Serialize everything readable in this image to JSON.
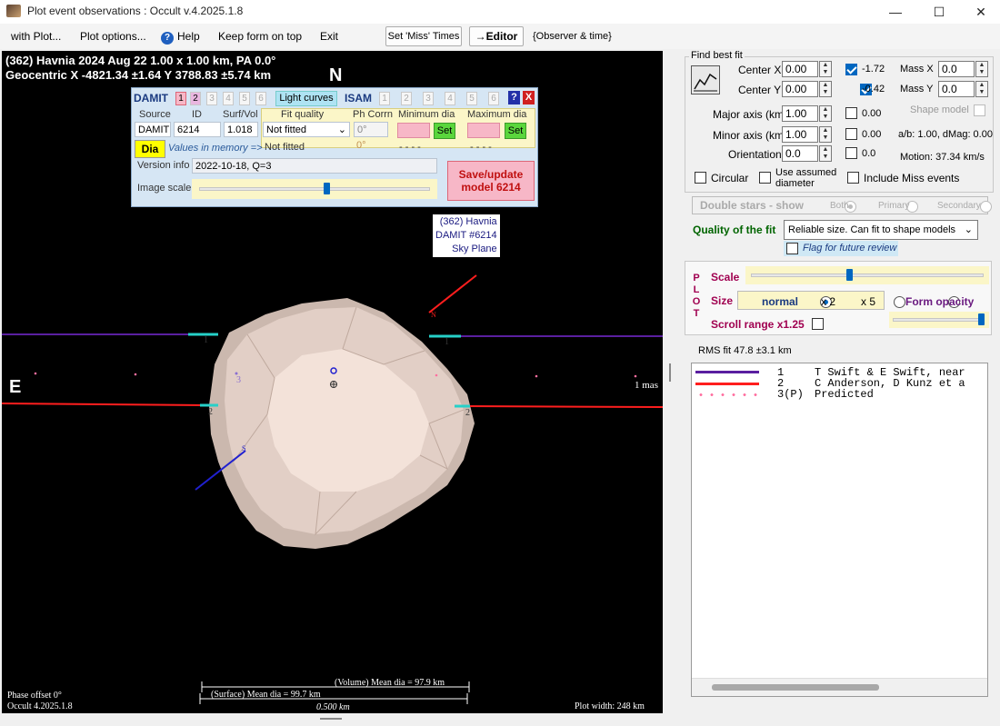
{
  "window": {
    "title": "Plot event observations : Occult v.4.2025.1.8",
    "minimize_icon": "minimize-icon",
    "maximize_icon": "maximize-icon",
    "close_icon": "close-icon"
  },
  "menu": {
    "items": [
      "with Plot...",
      "Plot options...",
      "Help",
      "Keep form on top",
      "Exit"
    ],
    "set_miss_times": "Set 'Miss' Times",
    "editor": "→Editor",
    "observer_time": "{Observer & time}"
  },
  "plot": {
    "header_line1": "(362) Havnia  2024 Aug 22   1.00 x 1.00 km, PA 0.0°",
    "header_line2": "Geocentric  X  -4821.34 ±1.64  Y 3788.83 ±5.74 km",
    "north": "N",
    "east": "E",
    "tag_lines": [
      "(362) Havnia",
      "DAMIT #6214",
      "Sky Plane"
    ],
    "scale_mas": "1 mas",
    "chord_labels": [
      "1",
      "1",
      "2",
      "2",
      "3"
    ],
    "pole_labels": [
      "N",
      "S"
    ],
    "phase_offset": "Phase offset 0°",
    "occult_version": "Occult 4.2025.1.8",
    "plot_width": "Plot width: 248 km",
    "volume_dia": "(Volume) Mean dia = 97.9 km",
    "surface_dia": "(Surface) Mean dia = 99.7 km",
    "scale_bar": "0.500 km",
    "colors": {
      "chord1": "#5a1fa0",
      "chord2": "#ff1e1e",
      "predicted": "#ff6fa0",
      "pole_n": "#ff1e1e",
      "pole_s": "#2020d0",
      "shape": "#f0ddd4"
    }
  },
  "damit": {
    "label": "DAMIT",
    "model_nums": [
      "1",
      "2",
      "3",
      "4",
      "5",
      "6"
    ],
    "light_curves": "Light curves",
    "isam": "ISAM",
    "isam_nums": [
      "1",
      "2",
      "3",
      "4",
      "5",
      "6"
    ],
    "help_q": "?",
    "close_x": "X",
    "col_source": "Source",
    "col_id": "ID",
    "col_surf": "Surf/Vol",
    "col_fit": "Fit quality",
    "col_phcorn": "Ph Corrn",
    "col_min": "Minimum dia",
    "col_max": "Maximum dia",
    "source": "DAMIT",
    "id": "6214",
    "surf": "1.018",
    "fit_quality": "Not fitted",
    "fit_quality2": "Not fitted",
    "ph_corr": "0°",
    "ph_corr2": "0°",
    "min_dash": "- - - -",
    "max_dash": "- - - -",
    "set": "Set",
    "dia": "Dia",
    "values_memory": "Values in memory =>",
    "version_label": "Version info",
    "version": "2022-10-18, Q=3",
    "image_scale": "Image scale",
    "save_line1": "Save/update",
    "save_line2": "model 6214",
    "image_scale_value": 0.55
  },
  "fit": {
    "group_label": "Find best fit",
    "fit_icon": "fit-chart-icon",
    "center_x_label": "Center X",
    "center_x": "0.00",
    "center_x_cb": "-1.72",
    "center_y_label": "Center Y",
    "center_y": "0.00",
    "center_y_cb": "-0.42",
    "mass_x_label": "Mass X",
    "mass_x": "0.0",
    "mass_y_label": "Mass Y",
    "mass_y": "0.0",
    "major_label": "Major axis (km)",
    "major": "1.00",
    "major_cb": "0.00",
    "minor_label": "Minor axis (km)",
    "minor": "1.00",
    "minor_cb": "0.00",
    "orient_label": "Orientation",
    "orient": "0.0",
    "orient_cb": "0.0",
    "shape_model": "Shape model",
    "ab_text": "a/b: 1.00, dMag: 0.00",
    "motion": "Motion: 37.34 km/s",
    "circular": "Circular",
    "use_assumed_1": "Use assumed",
    "use_assumed_2": "diameter",
    "include_miss": "Include Miss events",
    "double_stars": "Double stars - show",
    "both": "Both",
    "primary": "Primary",
    "secondary": "Secondary",
    "quality_label": "Quality of the fit",
    "quality_value": "Reliable size. Can fit to shape models",
    "flag_review": "Flag for future review"
  },
  "plotopts": {
    "plot_letters": [
      "P",
      "L",
      "O",
      "T"
    ],
    "scale": "Scale",
    "size": "Size",
    "normal": "normal",
    "x2": "x 2",
    "x5": "x 5",
    "form_opacity": "Form opacity",
    "scroll_range": "Scroll range x1.25",
    "scale_value": 0.42,
    "opacity_value": 0.97
  },
  "rms": "RMS fit 47.8 ±3.1 km",
  "legend": [
    {
      "num": "1",
      "text": "T Swift & E Swift, near",
      "color": "#5a1fa0",
      "style": "solid"
    },
    {
      "num": "2",
      "text": "C Anderson, D Kunz et a",
      "color": "#ff1e1e",
      "style": "solid"
    },
    {
      "num": "3(P)",
      "text": "Predicted",
      "color": "#ff6fa0",
      "style": "dotted"
    }
  ]
}
